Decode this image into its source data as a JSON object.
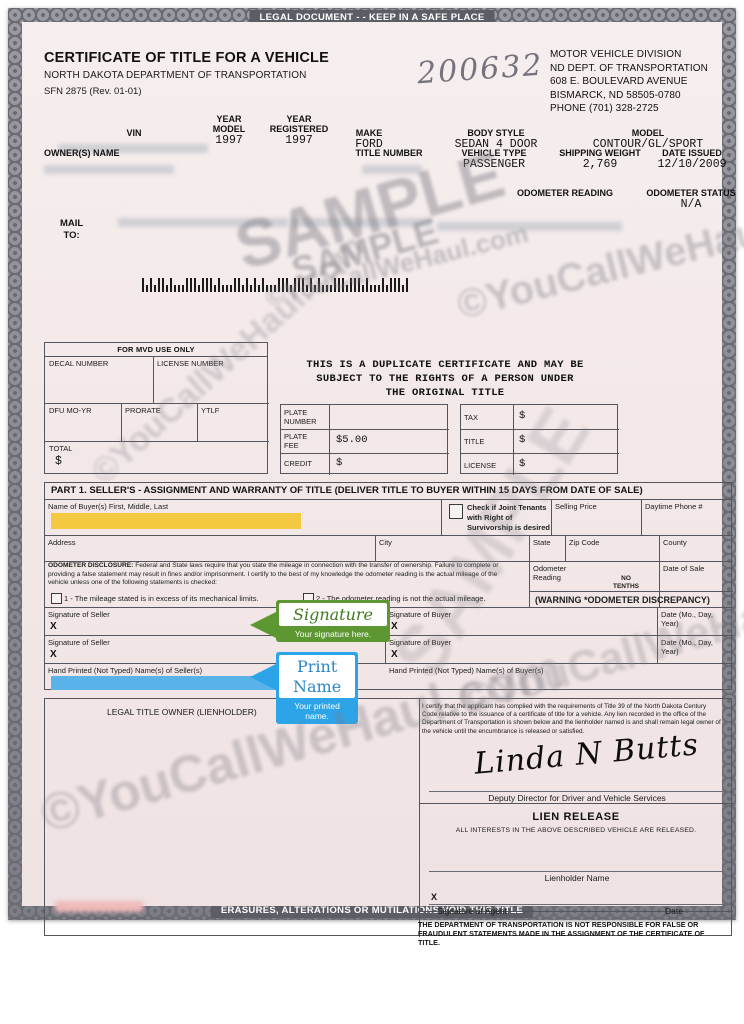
{
  "document": {
    "top_band": "LEGAL DOCUMENT - - KEEP IN A SAFE PLACE",
    "bottom_band": "ERASURES, ALTERATIONS OR MUTILATIONS VOID THIS TITLE",
    "title": "CERTIFICATE OF TITLE FOR A VEHICLE",
    "subtitle": "NORTH DAKOTA DEPARTMENT OF TRANSPORTATION",
    "form_number": "SFN 2875 (Rev. 01-01)",
    "handwritten_number": "200632"
  },
  "agency": {
    "line1": "MOTOR VEHICLE DIVISION",
    "line2": "ND DEPT. OF TRANSPORTATION",
    "line3": "608 E. BOULEVARD AVENUE",
    "line4": "BISMARCK, ND 58505-0780",
    "line5": "PHONE (701) 328-2725"
  },
  "vehicle": {
    "vin_label": "VIN",
    "vin_value": "",
    "year_model_label_1": "YEAR",
    "year_model_label_2": "MODEL",
    "year_model_value": "1997",
    "year_registered_label_1": "YEAR",
    "year_registered_label_2": "REGISTERED",
    "year_registered_value": "1997",
    "make_label": "MAKE",
    "make_value": "FORD",
    "body_style_label": "BODY STYLE",
    "body_style_value": "SEDAN 4 DOOR",
    "model_label": "MODEL",
    "model_value": "CONTOUR/GL/SPORT",
    "owners_name_label": "OWNER(S) NAME",
    "owners_name_value": "",
    "title_number_label": "TITLE NUMBER",
    "title_number_value": "",
    "vehicle_type_label": "VEHICLE TYPE",
    "vehicle_type_value": "PASSENGER",
    "shipping_weight_label": "SHIPPING WEIGHT",
    "shipping_weight_value": "2,769",
    "date_issued_label": "DATE ISSUED",
    "date_issued_value": "12/10/2009",
    "odometer_reading_label": "ODOMETER READING",
    "odometer_status_label": "ODOMETER STATUS",
    "odometer_status_value": "N/A"
  },
  "mail": {
    "label_line1": "MAIL",
    "label_line2": "TO:"
  },
  "mvd_box": {
    "header": "FOR MVD USE ONLY",
    "decal_number": "DECAL NUMBER",
    "license_number": "LICENSE NUMBER",
    "dfu_mo_yr": "DFU MO-YR",
    "prorate": "PRORATE",
    "ytlf": "YTLF",
    "total": "TOTAL",
    "total_currency": "$"
  },
  "duplicate_notice": {
    "line1": "THIS IS A DUPLICATE CERTIFICATE AND MAY BE",
    "line2": "SUBJECT TO THE RIGHTS OF A PERSON UNDER",
    "line3": "THE ORIGINAL TITLE"
  },
  "plate_box": {
    "plate_number_l1": "PLATE",
    "plate_number_l2": "NUMBER",
    "plate_number_value": "",
    "plate_fee_l1": "PLATE",
    "plate_fee_l2": "FEE",
    "plate_fee_value": "$5.00",
    "credit_label": "CREDIT",
    "credit_value": "$"
  },
  "fee_box": {
    "tax_label": "TAX",
    "tax_value": "$",
    "title_label": "TITLE",
    "title_value": "$",
    "license_label": "LICENSE",
    "license_value": "$"
  },
  "part1": {
    "header": "PART 1. SELLER'S - ASSIGNMENT AND WARRANTY OF TITLE (DELIVER TITLE TO BUYER WITHIN 15 DAYS FROM DATE OF SALE)",
    "buyer_name_label": "Name of Buyer(s) First, Middle, Last",
    "joint_tenants_l1": "Check if Joint Tenants",
    "joint_tenants_l2": "with Right of",
    "joint_tenants_l3": "Survivorship is desired",
    "selling_price_label": "Selling Price",
    "daytime_phone_label": "Daytime Phone #",
    "address_label": "Address",
    "city_label": "City",
    "state_label": "State",
    "zip_label": "Zip Code",
    "county_label": "County",
    "odometer_disclosure_bold": "ODOMETER DISCLOSURE:",
    "odometer_disclosure_text": " Federal and State laws require that you state the mileage in connection with the transfer of ownership. Failure to complete or providing a false statement may result in fines and/or imprisonment. I certify to the best of my knowledge the odometer reading is the actual mileage of the vehicle unless one of the following statements is checked:",
    "check1": "1 - The mileage stated is in excess of its mechanical limits.",
    "check2": "2 - The odometer reading is not the actual mileage.",
    "odometer_reading_l1": "Odometer",
    "odometer_reading_l2": "Reading",
    "no_tenths_l1": "NO",
    "no_tenths_l2": "TENTHS",
    "date_of_sale_label": "Date of Sale",
    "warning": "(WARNING *ODOMETER DISCREPANCY)",
    "signature_of_seller": "Signature of Seller",
    "signature_of_buyer": "Signature of Buyer",
    "date_label": "Date (Mo., Day, Year)",
    "hand_printed_seller": "Hand Printed (Not Typed) Name(s) of Seller(s)",
    "hand_printed_buyer": "Hand Printed (Not Typed) Name(s) of Buyer(s)",
    "x_mark": "X"
  },
  "callouts": {
    "signature": {
      "title": "Signature",
      "caption": "Your signature here.",
      "color": "#5d9732"
    },
    "print_name": {
      "title": "Print Name",
      "caption": "Your printed name.",
      "color": "#2da3e8"
    }
  },
  "lienholder": {
    "title": "LEGAL TITLE OWNER (LIENHOLDER)",
    "certification": "I certify that the applicant has complied with the requirements of Title 39 of the North Dakota Century Code relative to the issuance of a certificate of title for a vehicle. Any lien recorded in the office of the Department of Transportation is shown below and the lienholder named is and shall remain legal owner of the vehicle until the encumbrance is released or satisfied.",
    "deputy_signature": "Linda N Butts",
    "deputy_title": "Deputy Director for Driver and Vehicle Services",
    "lien_release_title": "LIEN RELEASE",
    "lien_release_sub": "ALL INTERESTS IN THE ABOVE DESCRIBED VEHICLE ARE RELEASED.",
    "lienholder_name_label": "Lienholder Name",
    "signature_of_agent": "Signature of Agent",
    "date_label": "Date",
    "x_mark": "X"
  },
  "disclaimer": "THE DEPARTMENT OF TRANSPORTATION IS NOT RESPONSIBLE FOR FALSE OR FRAUDULENT STATEMENTS MADE IN THE ASSIGNMENT OF THE CERTIFICATE OF TITLE.",
  "watermarks": {
    "sample": "SAMPLE",
    "site": "©YouCallWeHaul.com"
  }
}
